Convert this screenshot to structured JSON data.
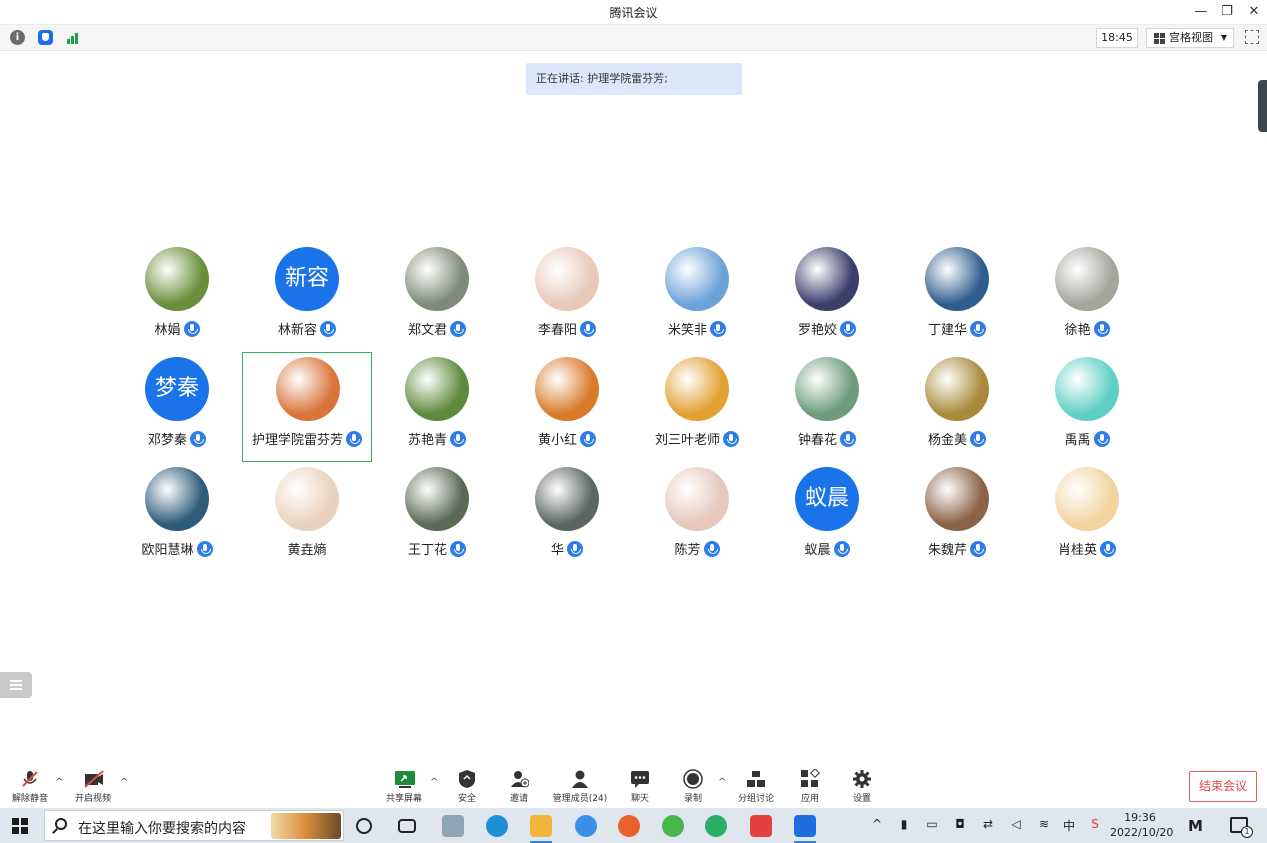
{
  "window": {
    "title": "腾讯会议"
  },
  "topbar": {
    "time": "18:45",
    "view_label": "宫格视图",
    "icons": [
      "info-icon",
      "shield-icon",
      "signal-icon",
      "fullscreen-icon"
    ]
  },
  "speaking_banner": "正在讲话: 护理学院雷芬芳;",
  "participants": [
    {
      "name": "林娟",
      "avatar": "photo",
      "color": "#6a8e3a",
      "mic": true
    },
    {
      "name": "林新容",
      "avatar_text": "新容",
      "mic": true
    },
    {
      "name": "郑文君",
      "avatar": "photo",
      "color": "#7f8a78",
      "mic": true
    },
    {
      "name": "李春阳",
      "avatar": "photo",
      "color": "#e8c9b9",
      "mic": true
    },
    {
      "name": "米笑非",
      "avatar": "photo",
      "color": "#6da2d8",
      "mic": true
    },
    {
      "name": "罗艳姣",
      "avatar": "photo",
      "color": "#3c3d6b",
      "mic": true
    },
    {
      "name": "丁建华",
      "avatar": "photo",
      "color": "#2f5d8e",
      "mic": true
    },
    {
      "name": "徐艳",
      "avatar": "photo",
      "color": "#a5a49d",
      "mic": true
    },
    {
      "name": "邓梦秦",
      "avatar_text": "梦秦",
      "mic": true
    },
    {
      "name": "护理学院雷芬芳",
      "avatar": "photo",
      "color": "#d9743a",
      "mic": true,
      "selected": true
    },
    {
      "name": "苏艳青",
      "avatar": "photo",
      "color": "#5e8a3c",
      "mic": true
    },
    {
      "name": "黄小红",
      "avatar": "photo",
      "color": "#d97a2a",
      "mic": true
    },
    {
      "name": "刘三叶老师",
      "avatar": "photo",
      "color": "#e2a132",
      "mic": true
    },
    {
      "name": "钟春花",
      "avatar": "photo",
      "color": "#6d9b7b",
      "mic": true
    },
    {
      "name": "杨金美",
      "avatar": "photo",
      "color": "#a88a3a",
      "mic": true
    },
    {
      "name": "禹禹",
      "avatar": "photo",
      "color": "#5fcfc5",
      "mic": true
    },
    {
      "name": "欧阳慧琳",
      "avatar": "photo",
      "color": "#2d5c7a",
      "mic": true
    },
    {
      "name": "黄垚熵",
      "avatar": "photo",
      "color": "#e9d2bd",
      "mic": false
    },
    {
      "name": "王丁花",
      "avatar": "photo",
      "color": "#5b6a55",
      "mic": true
    },
    {
      "name": "华",
      "avatar": "photo",
      "color": "#5c6560",
      "mic": true
    },
    {
      "name": "陈芳",
      "avatar": "photo",
      "color": "#e5c7bb",
      "mic": true
    },
    {
      "name": "蚁晨",
      "avatar_text": "蚁晨",
      "mic": true
    },
    {
      "name": "朱魏芹",
      "avatar": "photo",
      "color": "#8a6245",
      "mic": true
    },
    {
      "name": "肖桂英",
      "avatar": "photo",
      "color": "#f1d4a0",
      "mic": true
    }
  ],
  "meeting_toolbar": {
    "unmute": "解除静音",
    "start_video": "开启视频",
    "share_screen": "共享屏幕",
    "security": "安全",
    "invite": "邀请",
    "manage_members": "管理成员(24)",
    "chat": "聊天",
    "record": "录制",
    "breakout": "分组讨论",
    "apps": "应用",
    "settings": "设置",
    "end_meeting": "结束会议"
  },
  "taskbar": {
    "search_placeholder": "在这里输入你要搜索的内容",
    "time": "19:36",
    "date": "2022/10/20",
    "ime": "中",
    "notification_count": "1"
  }
}
